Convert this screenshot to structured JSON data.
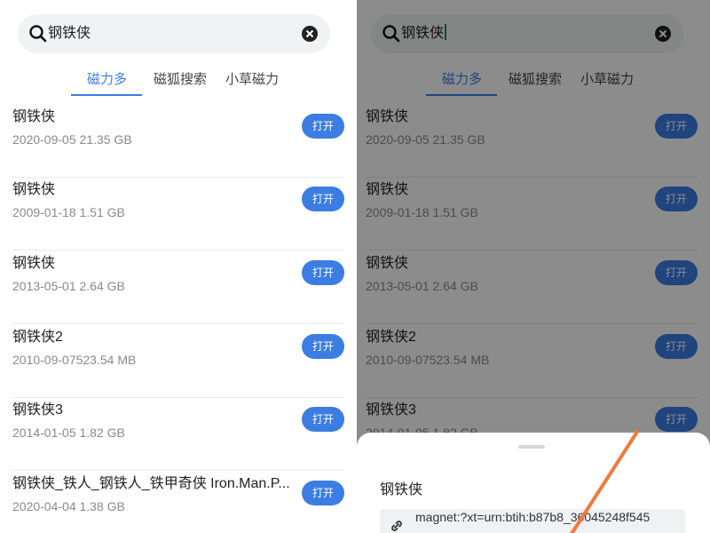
{
  "search": {
    "query": "钢铁侠"
  },
  "tabs": [
    {
      "label": "磁力多",
      "active": true
    },
    {
      "label": "磁狐搜索",
      "active": false
    },
    {
      "label": "小草磁力",
      "active": false
    }
  ],
  "results": [
    {
      "title": "钢铁侠",
      "meta": "2020-09-05  21.35 GB",
      "button": "打开"
    },
    {
      "title": "钢铁侠",
      "meta": "2009-01-18 1.51 GB",
      "button": "打开"
    },
    {
      "title": "钢铁侠",
      "meta": "2013-05-01 2.64 GB",
      "button": "打开"
    },
    {
      "title": "钢铁侠2",
      "meta": "2010-09-07523.54 MB",
      "button": "打开"
    },
    {
      "title": "钢铁侠3",
      "meta": "2014-01-05 1.82 GB",
      "button": "打开"
    },
    {
      "title": "钢铁侠_铁人_钢铁人_铁甲奇侠 Iron.Man.P...",
      "meta": "2020-04-04  1.38 GB",
      "button": "打开"
    }
  ],
  "sheet": {
    "title": "钢铁侠",
    "magnet": "magnet:?xt=urn:btih:b87b8_36045248f545"
  },
  "colors": {
    "accent": "#3b7de3",
    "annotation_arrow": "#f07a3a"
  }
}
